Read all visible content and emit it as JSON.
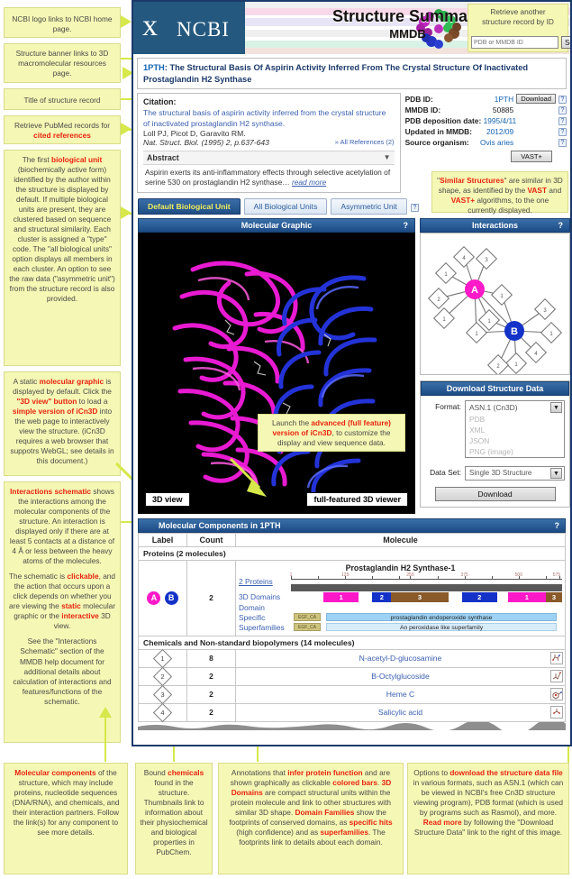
{
  "header": {
    "logo_word": "NCBI",
    "banner_title": "Structure Summary",
    "banner_sub": "MMDB",
    "retrieve_line1": "Retrieve another",
    "retrieve_line2": "structure record by ID",
    "retrieve_placeholder": "PDB or MMDB ID",
    "search_button": "Search"
  },
  "record": {
    "pdb_id": "1PTH",
    "title_rest": ": The Structural Basis Of Aspirin Activity Inferred From The Crystal Structure Of Inactivated Prostaglandin H2 Synthase"
  },
  "citation": {
    "label": "Citation:",
    "title": "The structural basis of aspirin activity inferred from the crystal structure of inactivated prostaglandin H2 synthase.",
    "authors": "Loll PJ, Picot D, Garavito RM.",
    "journal": "Nat. Struct. Biol. (1995) 2, p.637-643",
    "all_references": "» All References (2)",
    "abstract_label": "Abstract",
    "abstract_text": "Aspirin exerts its anti-inflammatory effects through selective acetylation of serine 530 on prostaglandin H2 synthase…",
    "read_more": "read more"
  },
  "ids": {
    "rows": [
      {
        "key": "PDB ID:",
        "value": "1PTH"
      },
      {
        "key": "MMDB ID:",
        "value": "50885"
      },
      {
        "key": "PDB deposition date:",
        "value": "1995/4/11"
      },
      {
        "key": "Updated in MMDB:",
        "value": "2012/09"
      },
      {
        "key": "Source organism:",
        "value": "Ovis aries"
      }
    ],
    "download_button": "Download",
    "vast_button": "VAST+",
    "help_glyph": "?"
  },
  "unit_tabs": [
    {
      "label": "Default Biological Unit",
      "selected": true
    },
    {
      "label": "All Biological Units",
      "selected": false
    },
    {
      "label": "Asymmetric Unit",
      "selected": false
    }
  ],
  "panels": {
    "molecular_graphic": "Molecular Graphic",
    "interactions": "Interactions",
    "download_structure_data": "Download Structure Data",
    "molecular_components": "Molecular Components in 1PTH",
    "help_glyph": "?"
  },
  "graphic_buttons": {
    "view_3d": "3D view",
    "full_viewer": "full-featured 3D viewer"
  },
  "interactions_nodes": {
    "node_a": "A",
    "node_b": "B"
  },
  "download": {
    "format_label": "Format:",
    "format_value": "ASN.1 (Cn3D)",
    "format_options": [
      "PDB",
      "XML",
      "JSON",
      "PNG (image)"
    ],
    "dataset_label": "Data Set:",
    "dataset_value": "Single 3D Structure",
    "download_button": "Download"
  },
  "components": {
    "headers": [
      "Label",
      "Count",
      "Molecule"
    ],
    "proteins_section": "Proteins (2 molecules)",
    "protein_row": {
      "labels": [
        "A",
        "B"
      ],
      "count": "2",
      "molecule_title": "Prostaglandin H2 Synthase-1",
      "row_labels": [
        "2 Proteins",
        "3D Domains",
        "Domain",
        "Specific",
        "Superfamilies"
      ],
      "ruler_ticks": [
        "1",
        "125",
        "250",
        "375",
        "500",
        "575"
      ],
      "domains": [
        {
          "label": "1",
          "color": "#ff18c8",
          "start": 12,
          "width": 13
        },
        {
          "label": "2",
          "color": "#1432c8",
          "start": 30,
          "width": 7
        },
        {
          "label": "3",
          "color": "#8a5a2b",
          "start": 37,
          "width": 21
        },
        {
          "label": "2",
          "color": "#1432c8",
          "start": 63,
          "width": 13
        },
        {
          "label": "1",
          "color": "#ff18c8",
          "start": 80,
          "width": 14
        },
        {
          "label": "3",
          "color": "#8a5a2b",
          "start": 94,
          "width": 6
        }
      ],
      "cd_specific_label": "EGF_CA",
      "cd_specific": "prostaglandin endoperoxide synthase",
      "cd_super_label": "EGF_CA",
      "cd_super": "An peroxidase like superfamily"
    },
    "chemicals_section": "Chemicals and Non-standard biopolymers (14 molecules)",
    "chemicals": [
      {
        "label": "1",
        "count": "8",
        "name": "N-acetyl-D-glucosamine"
      },
      {
        "label": "2",
        "count": "2",
        "name": "B-Octylglucoside"
      },
      {
        "label": "3",
        "count": "2",
        "name": "Heme C"
      },
      {
        "label": "4",
        "count": "2",
        "name": "Salicylic acid"
      }
    ]
  },
  "notes": {
    "logo": "NCBI logo links to NCBI home page.",
    "banner": "Structure banner links to 3D macromolecular resources page.",
    "title": "Title of structure record",
    "pubmed": [
      "Retrieve PubMed records for ",
      "cited references"
    ],
    "biounit": "The first biological unit (biochemically active form) identified by the author within the structure is displayed by default. If multiple biological units are present, they are clustered based on sequence and structural similarity. Each cluster is assigned a \"type\" code. The \"all biological units\" option displays all members in each cluster. An option to see the raw data (\"asymmetric unit\") from the structure record is also provided.",
    "graphic": "A static molecular graphic is displayed by default. Click the \"3D view\" button to load a simple version of iCn3D into the web page to interactively view the structure. (iCn3D requires a web browser that suppotrs WebGL; see details in this document.)",
    "schematic1": "Interactions schematic shows the interactions among the molecular components of the structure. An interaction is displayed only if there are at least 5 contacts at a distance of 4 Å or less between the heavy atoms of the molecules.",
    "schematic2": "The schematic is clickable, and the action that occurs upon a click depends on whether you are viewing the static molecular graphic or the interactive 3D view.",
    "schematic3": "See the \"Interactions Schematic\" section of the MMDB help document for additional details about calculation of interactions and features/functions of the schematic.",
    "similar": "\"Similar Structures\" are similar in 3D shape, as identified by the VAST and VAST+ algorithms, to the one currently displayed.",
    "launch": "Launch the advanced (full feature) version of iCn3D, to customize the display and view sequence data.",
    "molcomp": "Molecular components of the structure, which may include proteins, nucleotide sequences (DNA/RNA), and chemicals, and their interaction partners. Follow the link(s) for any component to see more details.",
    "chemicals": "Bound chemicals found in the structure. Thumbnails link to information about their physiochemical and biological properties in PubChem.",
    "annotations": "Annotations that infer protein function and are shown graphically as clickable colored bars. 3D Domains are compact structural units within the protein molecule and link to other structures with similar 3D shape. Domain Families show the footprints of conserved domains, as specific hits (high confidence) and as superfamilies. The footprints link to details about each domain.",
    "downloadnote": "Options to download the structure data file in various formats, such as ASN.1 (which can be viewed in NCBI's free Cn3D structure viewing program), PDB format (which is used by programs such as Rasmol), and more. Read more by following the \"Download Structure Data\" link to the right of this image."
  },
  "colors": {
    "accent_blue": "#1b3a6b",
    "note_bg": "#f5f7b4",
    "arrow": "#d6e84a",
    "highlight_red": "#e8230f",
    "link_blue": "#3a5fb0",
    "chip_a": "#ff19c8",
    "chip_b": "#1432c8"
  }
}
